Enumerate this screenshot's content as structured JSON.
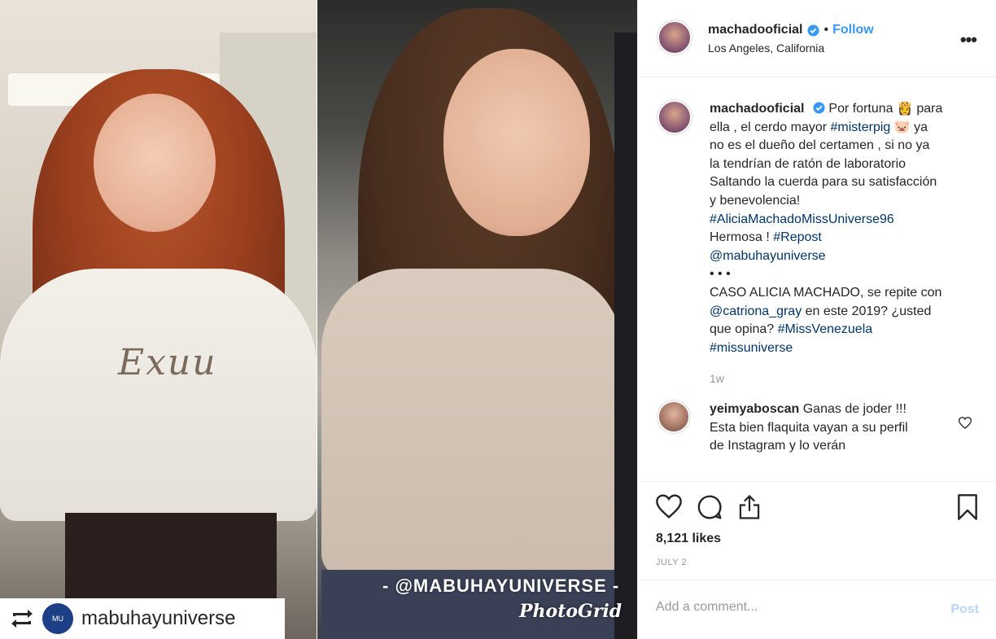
{
  "post": {
    "username": "machadooficial",
    "follow_label": "Follow",
    "location": "Los Angeles, California",
    "more_label": "•••"
  },
  "caption": {
    "username": "machadooficial",
    "line1": "Por fortuna 👸 para",
    "line2a": "ella , el cerdo mayor ",
    "tag_misterpig": "#misterpig",
    "line2b": " 🐷 ya",
    "line3": "no es el dueño del certamen , si no ya",
    "line4": "la tendrían de ratón de laboratorio",
    "line5": "Saltando la cuerda para su satisfacción",
    "line6": "y benevolencia!",
    "tag_alicia": "#AliciaMachadoMissUniverse96",
    "hermosa": "Hermosa ! ",
    "tag_repost": "#Repost",
    "mention_mabuhay": "@mabuhayuniverse",
    "dots": "•  •  •",
    "caso_line1": "CASO ALICIA MACHADO, se repite con",
    "mention_catriona": "@catriona_gray",
    "caso_line2b": " en este 2019? ¿usted",
    "caso_line3a": "que opina? ",
    "tag_missvenezuela": "#MissVenezuela",
    "tag_missuniverse": "#missuniverse",
    "time": "1w"
  },
  "comment": {
    "username": "yeimyaboscan",
    "text_line1": " Ganas de joder !!!",
    "text_line2": "Esta bien flaquita vayan a su perfil",
    "text_line3": "de Instagram y lo verán"
  },
  "stats": {
    "likes": "8,121 likes",
    "date": "JULY 2"
  },
  "add_comment": {
    "placeholder": "Add a comment...",
    "post_label": "Post"
  },
  "media": {
    "watermark": "- @MABUHAYUNIVERSE -",
    "photogrid": "PhotoGrid",
    "shirt_text": "Exuu",
    "repost_user": "mabuhayuniverse",
    "repost_avatar_text": "MU"
  },
  "icons": {
    "verified": "verified-badge-icon",
    "heart": "heart-icon",
    "comment": "comment-icon",
    "share": "share-icon",
    "bookmark": "bookmark-icon",
    "repost": "repost-icon"
  },
  "colors": {
    "link": "#003569",
    "follow": "#3897f0",
    "muted": "#999999",
    "post_disabled": "#b8d8f8"
  }
}
